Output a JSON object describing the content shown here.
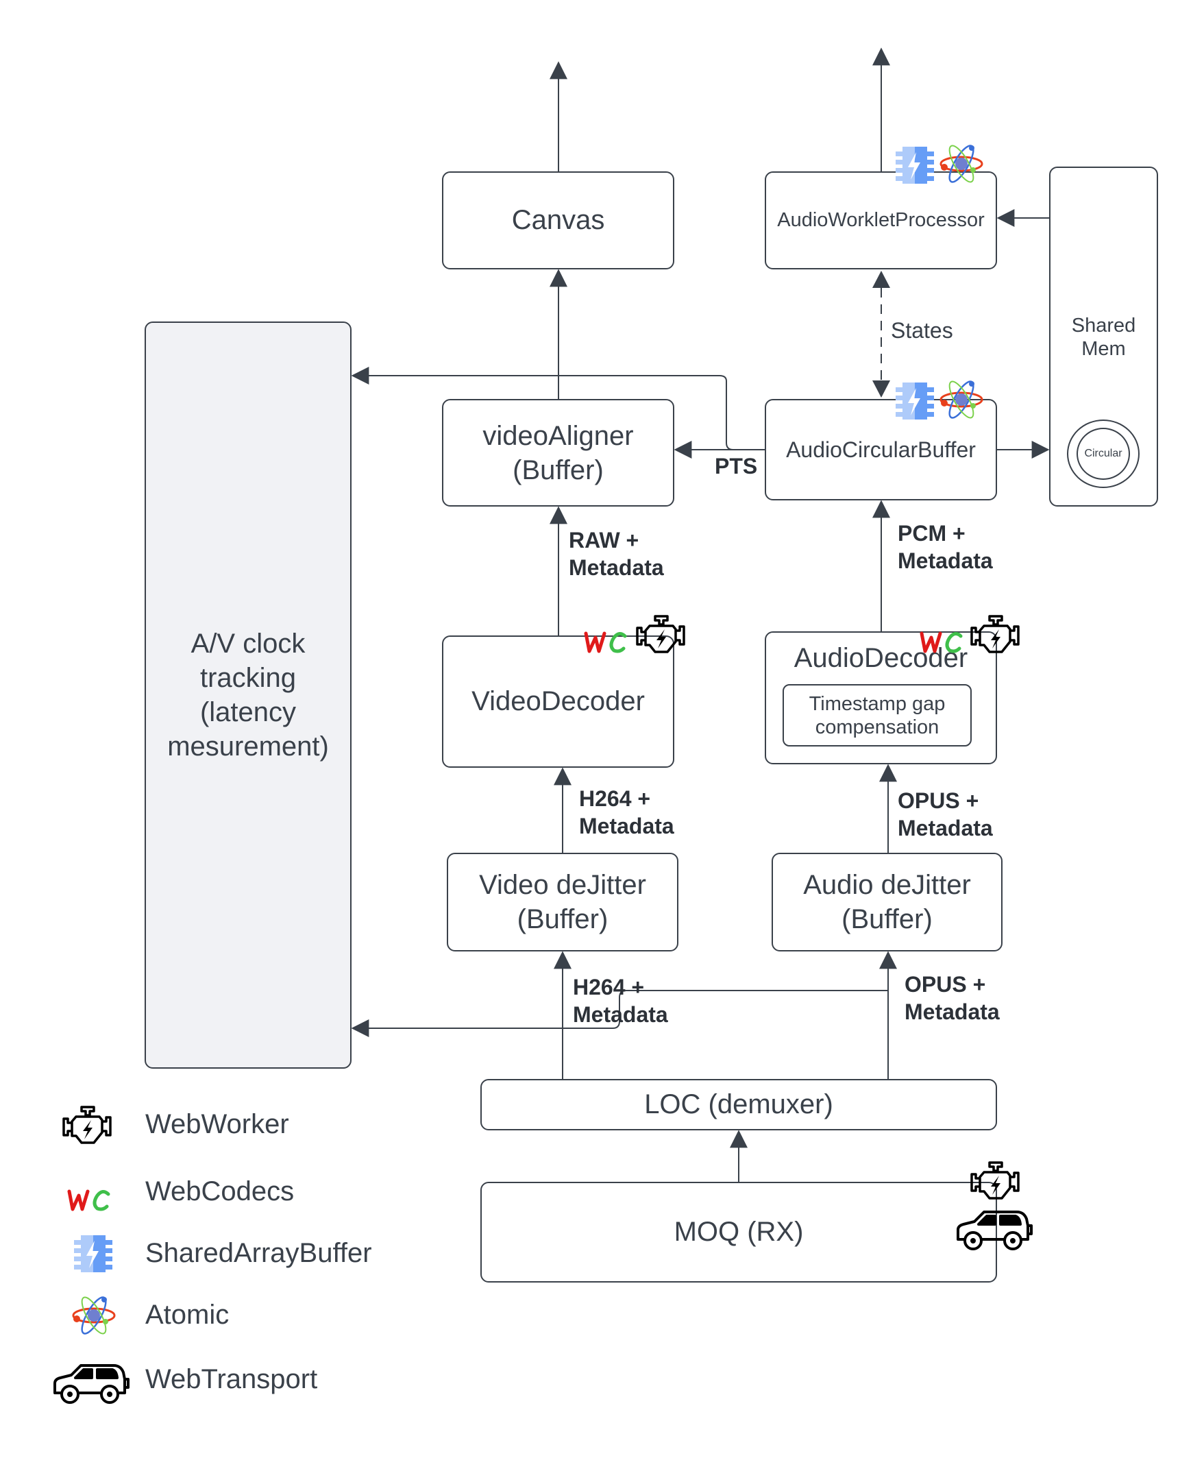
{
  "diagram": {
    "nodes": {
      "canvas": "Canvas",
      "audio_worklet": "AudioWorkletProcessor",
      "shared_mem": "Shared Mem",
      "circular": "Circular",
      "av_clock": "A/V clock tracking (latency mesurement)",
      "video_aligner": "videoAligner (Buffer)",
      "audio_circular_buffer": "AudioCircularBuffer",
      "video_decoder": "VideoDecoder",
      "audio_decoder": "AudioDecoder",
      "timestamp_gap": "Timestamp gap compensation",
      "video_dejitter": "Video deJitter (Buffer)",
      "audio_dejitter": "Audio deJitter (Buffer)",
      "loc": "LOC (demuxer)",
      "moq": "MOQ (RX)"
    },
    "edge_labels": {
      "states": "States",
      "pts": "PTS",
      "raw_metadata": "RAW + Metadata",
      "pcm_metadata": "PCM + Metadata",
      "h264_metadata_top": "H264 + Metadata",
      "opus_metadata_top": "OPUS + Metadata",
      "h264_metadata_bottom": "H264 + Metadata",
      "opus_metadata_bottom": "OPUS + Metadata"
    }
  },
  "legend": [
    {
      "icon": "webworker-icon",
      "label": "WebWorker"
    },
    {
      "icon": "webcodecs-icon",
      "label": "WebCodecs"
    },
    {
      "icon": "sharedarraybuffer-icon",
      "label": "SharedArrayBuffer"
    },
    {
      "icon": "atomic-icon",
      "label": "Atomic"
    },
    {
      "icon": "webtransport-icon",
      "label": "WebTransport"
    }
  ],
  "colors": {
    "line": "#3a414a",
    "wc_red": "#e01a1a",
    "wc_green": "#3fbf4a",
    "sab_light": "#aecbfa",
    "sab_dark": "#669df6",
    "clock_fill": "#f1f2f5"
  }
}
